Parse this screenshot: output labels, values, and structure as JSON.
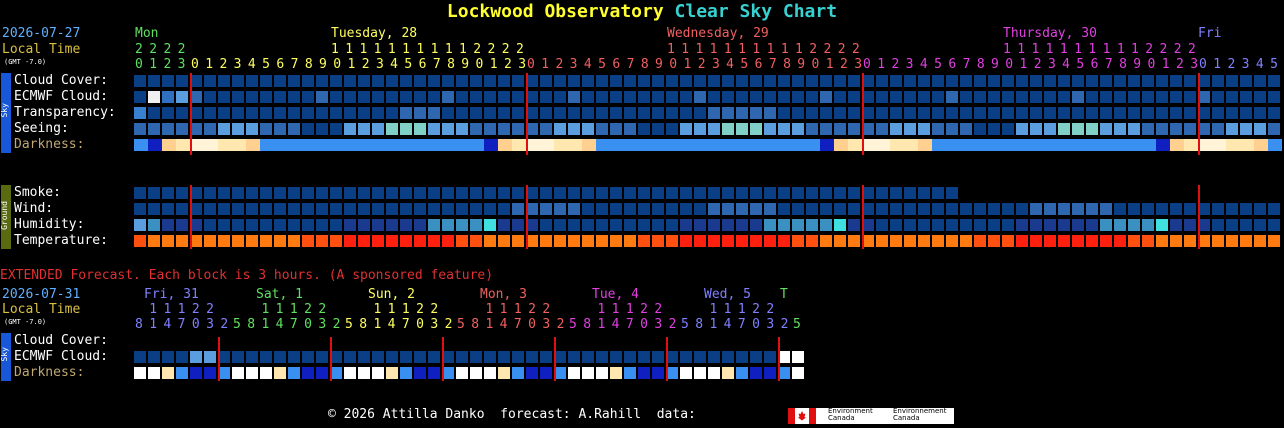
{
  "title": {
    "part1": "Lockwood Observatory",
    "part2": "Clear Sky Chart"
  },
  "colors": {
    "title_yellow": "#ffff30",
    "title_cyan": "#38d0d0",
    "cell_default": "#0b3f85",
    "midnight_line": "#e01010",
    "ext_header": "#e03030"
  },
  "main": {
    "date": "2026-07-27",
    "local_time": "Local Time",
    "gmt": "(GMT -7.0)",
    "days": [
      {
        "label": "Mon",
        "color": "#60e060"
      },
      {
        "label": "Tuesday, 28",
        "color": "#ffff60"
      },
      {
        "label": "Wednesday, 29",
        "color": "#f06060"
      },
      {
        "label": "Thursday, 30",
        "color": "#e040e0"
      },
      {
        "label": "Fri",
        "color": "#8080ff"
      }
    ],
    "hour_tens": [
      {
        "text": "2222",
        "color": "#60e060"
      },
      {
        "text": "11111111112222",
        "color": "#ffff60"
      },
      {
        "text": "11111111112222",
        "color": "#f06060"
      },
      {
        "text": "11111111112222",
        "color": "#e040e0"
      }
    ],
    "hour_ones": [
      {
        "text": "0123",
        "color": "#60e060"
      },
      {
        "text": "012345678901234567890123",
        "color": "#ffff60"
      },
      {
        "text": "012345678901234567890123",
        "color": "#f06060"
      },
      {
        "text": "012345678901234567890123",
        "color": "#e040e0"
      },
      {
        "text": "012345",
        "color": "#8080ff"
      }
    ],
    "sky_group": "Sky",
    "ground_group": "Ground",
    "rows": {
      "cloud": "Cloud Cover:",
      "ecmwf": "ECMWF Cloud:",
      "transparency": "Transparency:",
      "seeing": "Seeing:",
      "darkness": "Darkness:",
      "smoke": "Smoke:",
      "wind": "Wind:",
      "humidity": "Humidity:",
      "temperature": "Temperature:"
    }
  },
  "extended": {
    "header": "EXTENDED Forecast. Each block is 3 hours. (A sponsored feature)",
    "date": "2026-07-31",
    "local_time": "Local Time",
    "gmt": "(GMT -7.0)",
    "days": [
      {
        "label": "Fri, 31",
        "color": "#8080ff"
      },
      {
        "label": "Sat, 1",
        "color": "#60e060"
      },
      {
        "label": "Sun, 2",
        "color": "#ffff60"
      },
      {
        "label": "Mon, 3",
        "color": "#f06060"
      },
      {
        "label": "Tue, 4",
        "color": "#e040e0"
      },
      {
        "label": "Wed, 5",
        "color": "#8080ff"
      },
      {
        "label": "T",
        "color": "#60e060"
      }
    ],
    "hour_tens": [
      {
        "text": " 11122",
        "color": "#8080ff"
      },
      {
        "text": "  11122",
        "color": "#60e060"
      },
      {
        "text": "  11122",
        "color": "#ffff60"
      },
      {
        "text": "  11122",
        "color": "#f06060"
      },
      {
        "text": "  11122",
        "color": "#e040e0"
      },
      {
        "text": "  11122",
        "color": "#8080ff"
      }
    ],
    "hour_ones": [
      {
        "text": "8147032",
        "color": "#8080ff"
      },
      {
        "text": "58147032",
        "color": "#60e060"
      },
      {
        "text": "58147032",
        "color": "#ffff60"
      },
      {
        "text": "58147032",
        "color": "#f06060"
      },
      {
        "text": "58147032",
        "color": "#e040e0"
      },
      {
        "text": "58147032",
        "color": "#8080ff"
      },
      {
        "text": "5",
        "color": "#60e060"
      }
    ],
    "rows": {
      "cloud": "Cloud Cover:",
      "ecmwf": "ECMWF Cloud:",
      "darkness": "Darkness:"
    },
    "sky_group": "Sky"
  },
  "footer": {
    "text": "© 2026 Attilla Danko  forecast: A.Rahill  data:",
    "ec_en": "Environment Canada",
    "ec_fr": "Environnement Canada"
  }
}
